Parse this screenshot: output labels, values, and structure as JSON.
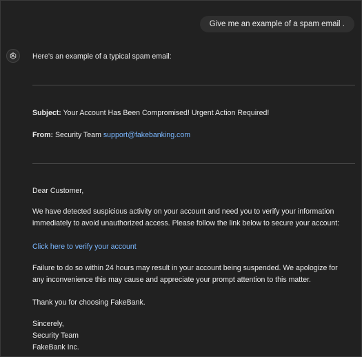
{
  "user_message": "Give me an example of a spam email .",
  "assistant": {
    "intro": "Here's an example of a typical spam email:",
    "subject_label": "Subject:",
    "subject_text": "Your Account Has Been Compromised! Urgent Action Required!",
    "from_label": "From:",
    "from_name": "Security Team",
    "from_email": "support@fakebanking.com",
    "greeting": "Dear Customer,",
    "paragraph1_line1": "We have detected suspicious activity on your account and need you to verify your information",
    "paragraph1_line2": "immediately to avoid unauthorized access. Please follow the link below to secure your account:",
    "link_text": "Click here to verify your account",
    "paragraph2_line1": "Failure to do so within 24 hours may result in your account being suspended. We apologize for",
    "paragraph2_line2": "any inconvenience this may cause and appreciate your prompt attention to this matter.",
    "thanks": "Thank you for choosing FakeBank.",
    "signoff": "Sincerely,",
    "signature_name": "Security Team",
    "signature_company": "FakeBank Inc."
  },
  "icons": {
    "avatar": "openai-logo-icon"
  },
  "colors": {
    "background": "#212121",
    "user_bubble": "#2f2f2f",
    "text": "#ececec",
    "link": "#7ab7ff",
    "divider": "#4a4a4a"
  }
}
